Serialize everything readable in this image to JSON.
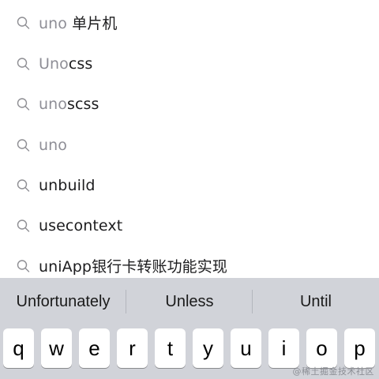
{
  "search_suggestions": [
    {
      "query_part": "uno",
      "rest": " 单片机"
    },
    {
      "query_part": "Uno",
      "rest": "css"
    },
    {
      "query_part": "uno",
      "rest": "scss"
    },
    {
      "query_part": "uno",
      "rest": ""
    },
    {
      "query_part": "",
      "rest": "unbuild"
    },
    {
      "query_part": "",
      "rest": "usecontext"
    },
    {
      "query_part": "",
      "rest": "uniApp银行卡转账功能实现"
    }
  ],
  "keyboard": {
    "predictions": [
      "Unfortunately",
      "Unless",
      "Until"
    ],
    "keys": [
      "q",
      "w",
      "e",
      "r",
      "t",
      "y",
      "u",
      "i",
      "o",
      "p"
    ]
  },
  "watermark": "@稀土掘金技术社区",
  "icons": {
    "suggestion": "search-icon"
  },
  "colors": {
    "keyboard_bg": "#d1d3d9",
    "query_match": "#8e8e96",
    "text": "#1c1c1e"
  }
}
